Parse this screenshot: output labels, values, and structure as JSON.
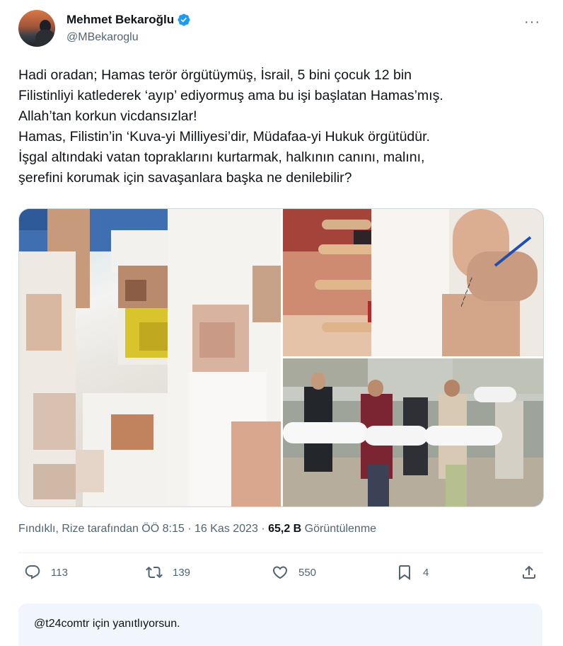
{
  "author": {
    "name": "Mehmet Bekaroğlu",
    "handle": "@MBekaroglu"
  },
  "tweet": {
    "lines": [
      "Hadi oradan; Hamas terör örgütüymüş, İsrail, 5 bini çocuk 12 bin",
      "Filistinliyi katlederek ‘ayıp’ ediyormuş ama bu işi başlatan Hamas’mış.",
      "Allah’tan korkun vicdansızlar!",
      "Hamas, Filistin’in ‘Kuva-yi Milliyesi’dir, Müdafaa-yi Hukuk örgütüdür.",
      "İşgal altındaki vatan topraklarını kurtarmak, halkının canını, malını,",
      "şerefini korumak için savaşanlara başka ne denilebilir?"
    ]
  },
  "meta": {
    "location_time": "Fındıklı, Rize tarafından ÖÖ 8:15 · 16 Kas 2023 · ",
    "views_count": "65,2 B",
    "views_label": " Görüntülenme"
  },
  "actions": {
    "replies": "113",
    "reposts": "139",
    "likes": "550",
    "bookmarks": "4"
  },
  "reply_context": "@t24comtr için yanıtlıyorsun.",
  "colors": {
    "text": "#0f1419",
    "secondary": "#536471",
    "verified": "#1d9bf0",
    "reply_bg": "#f0f6fb"
  },
  "icons": [
    "verified-badge-icon",
    "more-icon",
    "reply-icon",
    "repost-icon",
    "like-icon",
    "bookmark-icon",
    "share-icon"
  ]
}
